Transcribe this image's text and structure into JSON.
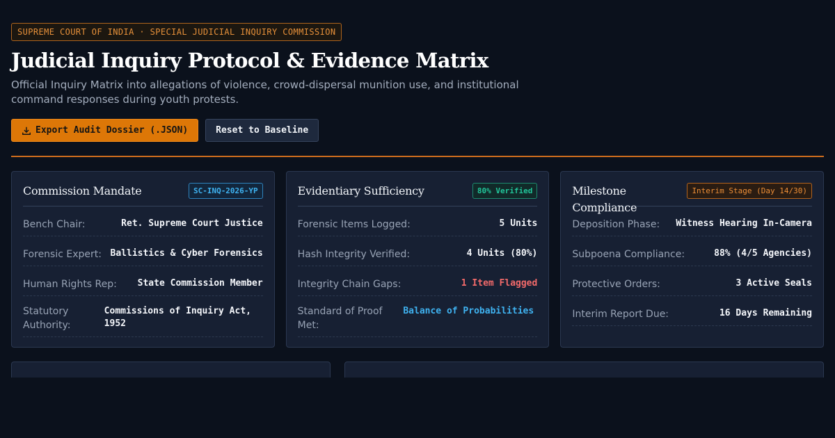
{
  "header": {
    "badge": "SUPREME COURT OF INDIA · SPECIAL JUDICIAL INQUIRY COMMISSION",
    "title": "Judicial Inquiry Protocol & Evidence Matrix",
    "subtitle": "Official Inquiry Matrix into allegations of violence, crowd-dispersal munition use, and institutional command responses during youth protests."
  },
  "actions": {
    "export_label": "Export Audit Dossier (.JSON)",
    "reset_label": "Reset to Baseline"
  },
  "icons": {
    "export": "download-icon"
  },
  "colors": {
    "accent": "#dd7707",
    "verified": "#22c59a",
    "flagged": "#f26a6a",
    "info": "#3fb2f0"
  },
  "cards": [
    {
      "title": "Commission Mandate",
      "badge": "SC-INQ-2026-YP",
      "rows": [
        {
          "label": "Bench Chair:",
          "value": "Ret. Supreme Court Justice"
        },
        {
          "label": "Forensic Expert:",
          "value": "Ballistics & Cyber Forensics"
        },
        {
          "label": "Human Rights Rep:",
          "value": "State Commission Member"
        },
        {
          "label": "Statutory Authority:",
          "value": "Commissions of Inquiry Act, 1952"
        }
      ]
    },
    {
      "title": "Evidentiary Sufficiency",
      "badge": "80% Verified",
      "rows": [
        {
          "label": "Forensic Items Logged:",
          "value": "5 Units"
        },
        {
          "label": "Hash Integrity Verified:",
          "value": "4 Units (80%)"
        },
        {
          "label": "Integrity Chain Gaps:",
          "value": "1 Item Flagged"
        },
        {
          "label": "Standard of Proof Met:",
          "value": "Balance of Probabilities"
        }
      ]
    },
    {
      "title": "Milestone Compliance",
      "badge": "Interim Stage (Day 14/30)",
      "rows": [
        {
          "label": "Deposition Phase:",
          "value": "Witness Hearing In-Camera"
        },
        {
          "label": "Subpoena Compliance:",
          "value": "88% (4/5 Agencies)"
        },
        {
          "label": "Protective Orders:",
          "value": "3 Active Seals"
        },
        {
          "label": "Interim Report Due:",
          "value": "16 Days Remaining"
        }
      ]
    }
  ]
}
